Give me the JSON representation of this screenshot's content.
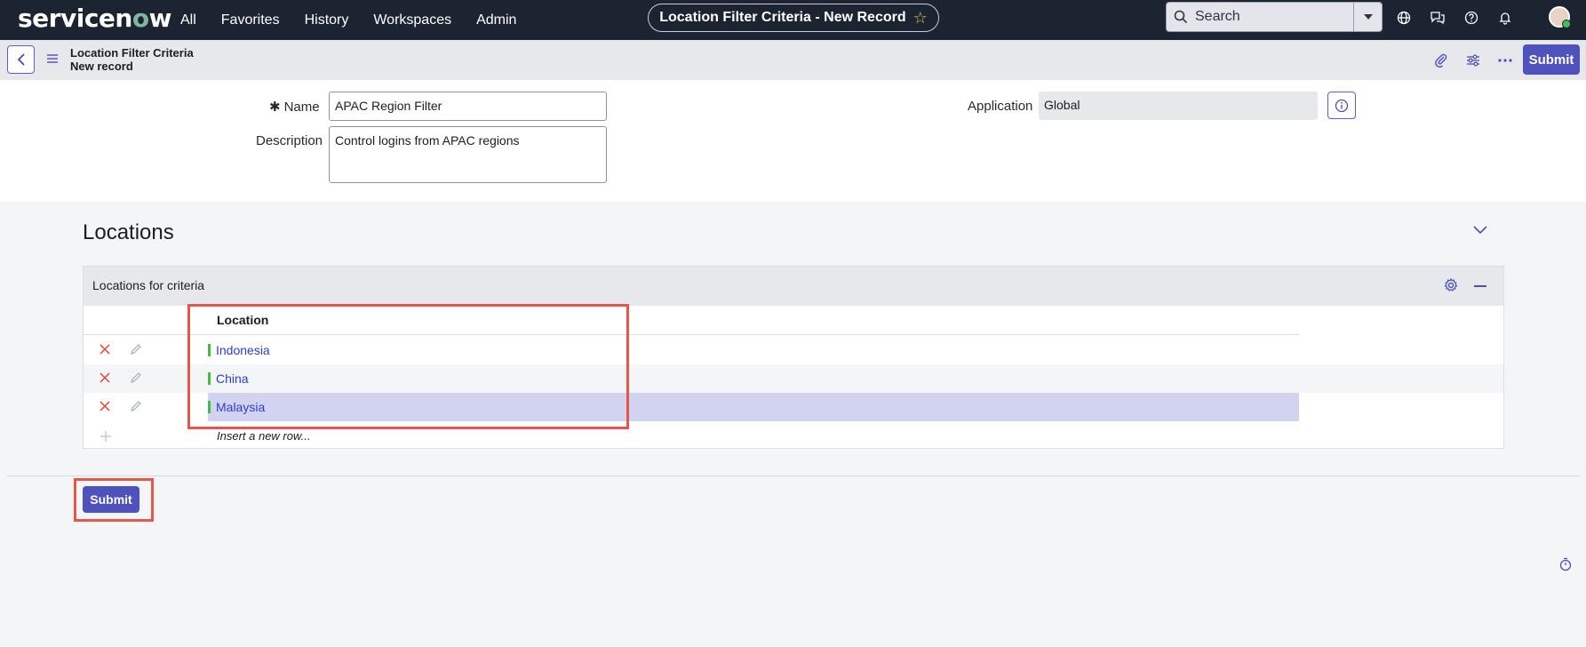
{
  "topnav": {
    "logo_text": "servicenow",
    "links": [
      "All",
      "Favorites",
      "History",
      "Workspaces",
      "Admin"
    ],
    "record_title": "Location Filter Criteria - New Record",
    "search_placeholder": "Search",
    "icons": [
      "globe-icon",
      "chat-icon",
      "help-icon",
      "bell-icon"
    ],
    "accent_color": "#4f52bd"
  },
  "record_header": {
    "table_name": "Location Filter Criteria",
    "record_state": "New record",
    "submit_label": "Submit"
  },
  "form": {
    "name_label": "Name",
    "name_value": "APAC Region Filter",
    "description_label": "Description",
    "description_value": "Control logins from APAC regions",
    "application_label": "Application",
    "application_value": "Global"
  },
  "related": {
    "section_title": "Locations",
    "list_title": "Locations for criteria",
    "column_header": "Location",
    "rows": [
      "Indonesia",
      "China",
      "Malaysia"
    ],
    "insert_text": "Insert a new row..."
  },
  "footer": {
    "submit_label": "Submit"
  }
}
